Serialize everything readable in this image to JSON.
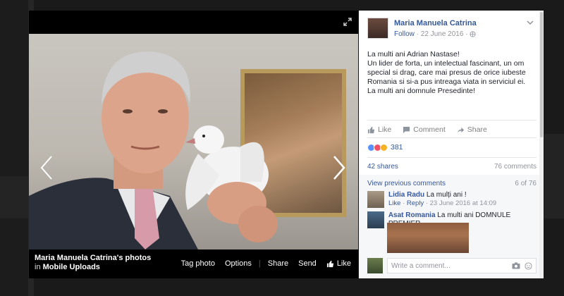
{
  "viewer": {
    "album_owner": "Maria Manuela Catrina's photos",
    "album_prefix": "in",
    "album_name": "Mobile Uploads",
    "actions": [
      "Tag photo",
      "Options",
      "Share",
      "Send"
    ],
    "like_label": "Like"
  },
  "post": {
    "author": "Maria Manuela Catrina",
    "follow": "Follow",
    "date": "22 June 2016",
    "lines": [
      "La multi ani Adrian Nastase!",
      "Un lider de forta, un intelectual fascinant, un om special si drag, care mai presus de orice iubeste Romania si si-a pus intreaga viata in serviciul ei.",
      "La multi ani domnule Presedinte!"
    ],
    "actions": {
      "like": "Like",
      "comment": "Comment",
      "share": "Share"
    },
    "reactions_count": "381",
    "shares": "42 shares",
    "comments_count": "76 comments"
  },
  "comments": {
    "view_previous": "View previous comments",
    "pager": "6 of 76",
    "items": [
      {
        "name": "Lidia Radu",
        "text": "La mulți ani !",
        "like": "Like",
        "reply": "Reply",
        "time": "23 June 2016 at 14:09"
      },
      {
        "name": "Asat Romania",
        "text": "La multi ani DOMNULE PREMIER"
      }
    ],
    "placeholder": "Write a comment..."
  },
  "colors": {
    "link": "#365899",
    "muted": "#90949c",
    "stage": "#000000",
    "reaction_like": "#5890ff",
    "reaction_love": "#f25268",
    "reaction_wow": "#f7b125"
  }
}
